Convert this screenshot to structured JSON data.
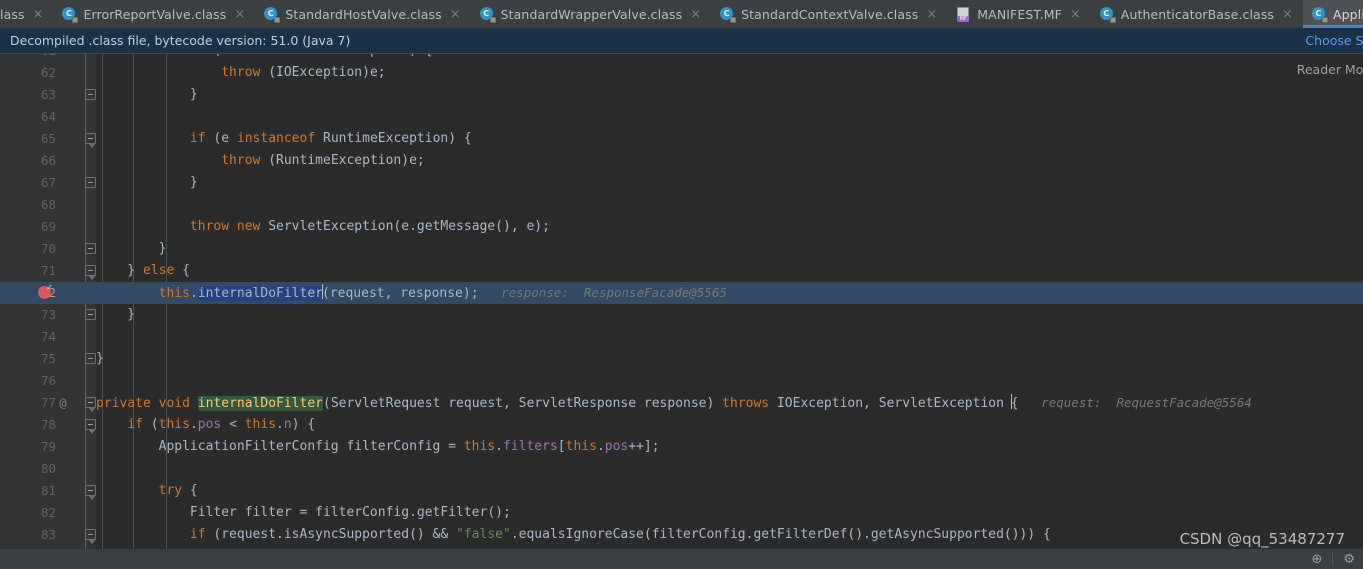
{
  "tabs": [
    {
      "label": "lass",
      "icon": "class-file-icon",
      "active": false,
      "truncated": true
    },
    {
      "label": "ErrorReportValve.class",
      "icon": "class-file-icon",
      "active": false
    },
    {
      "label": "StandardHostValve.class",
      "icon": "class-file-icon",
      "active": false
    },
    {
      "label": "StandardWrapperValve.class",
      "icon": "class-file-icon",
      "active": false
    },
    {
      "label": "StandardContextValve.class",
      "icon": "class-file-icon",
      "active": false
    },
    {
      "label": "MANIFEST.MF",
      "icon": "manifest-file-icon",
      "active": false
    },
    {
      "label": "AuthenticatorBase.class",
      "icon": "class-file-icon",
      "active": false
    },
    {
      "label": "ApplicationFilterChain.class",
      "icon": "class-file-icon",
      "active": true
    }
  ],
  "tab_close_glyph": "×",
  "notification": {
    "message": "Decompiled .class file, bytecode version: 51.0 (Java 7)",
    "action_label": "Choose Sources",
    "link_color": "#589df6",
    "background": "#1b3147"
  },
  "editor": {
    "reader_mode_label": "Reader Mode",
    "current_line": 72,
    "breakpoint_line": 72,
    "selected_token": "internalDoFilter",
    "lines": [
      {
        "no": 61,
        "clipped": true,
        "tokens": [
          {
            "t": "            ",
            "c": "pln"
          },
          {
            "t": "if",
            "c": "kw"
          },
          {
            "t": " (e ",
            "c": "pln"
          },
          {
            "t": "instanceof",
            "c": "kw"
          },
          {
            "t": " IOException) {",
            "c": "pln"
          }
        ]
      },
      {
        "no": 62,
        "tokens": [
          {
            "t": "                ",
            "c": "pln"
          },
          {
            "t": "throw",
            "c": "kw"
          },
          {
            "t": " (IOException)e;",
            "c": "pln"
          }
        ]
      },
      {
        "no": 63,
        "fold": true,
        "tokens": [
          {
            "t": "            }",
            "c": "pln"
          }
        ]
      },
      {
        "no": 64,
        "tokens": []
      },
      {
        "no": 65,
        "fold": true,
        "foldArrow": true,
        "tokens": [
          {
            "t": "            ",
            "c": "pln"
          },
          {
            "t": "if",
            "c": "kw"
          },
          {
            "t": " (e ",
            "c": "pln"
          },
          {
            "t": "instanceof",
            "c": "kw"
          },
          {
            "t": " RuntimeException) {",
            "c": "pln"
          }
        ]
      },
      {
        "no": 66,
        "tokens": [
          {
            "t": "                ",
            "c": "pln"
          },
          {
            "t": "throw",
            "c": "kw"
          },
          {
            "t": " (RuntimeException)e;",
            "c": "pln"
          }
        ]
      },
      {
        "no": 67,
        "fold": true,
        "tokens": [
          {
            "t": "            }",
            "c": "pln"
          }
        ]
      },
      {
        "no": 68,
        "tokens": []
      },
      {
        "no": 69,
        "tokens": [
          {
            "t": "            ",
            "c": "pln"
          },
          {
            "t": "throw",
            "c": "kw"
          },
          {
            "t": " ",
            "c": "pln"
          },
          {
            "t": "new",
            "c": "kw"
          },
          {
            "t": " ServletException(e.getMessage(), e);",
            "c": "pln"
          }
        ]
      },
      {
        "no": 70,
        "fold": true,
        "tokens": [
          {
            "t": "        }",
            "c": "pln"
          }
        ]
      },
      {
        "no": 71,
        "fold": true,
        "foldArrow": true,
        "tokens": [
          {
            "t": "    } ",
            "c": "pln"
          },
          {
            "t": "else",
            "c": "kw"
          },
          {
            "t": " {",
            "c": "pln"
          }
        ]
      },
      {
        "no": 72,
        "highlight": true,
        "breakpoint": true,
        "tokens": [
          {
            "t": "        ",
            "c": "pln"
          },
          {
            "t": "this",
            "c": "kw"
          },
          {
            "t": ".",
            "c": "pln"
          },
          {
            "t": "internalDoFilter",
            "c": "sel"
          },
          {
            "t": "|",
            "c": "caret"
          },
          {
            "t": "(request, response);",
            "c": "pln"
          }
        ],
        "hint": "response:  ResponseFacade@5565"
      },
      {
        "no": 73,
        "fold": true,
        "tokens": [
          {
            "t": "    }",
            "c": "pln"
          }
        ]
      },
      {
        "no": 74,
        "tokens": []
      },
      {
        "no": 75,
        "fold": true,
        "tokens": [
          {
            "t": "}",
            "c": "pln"
          }
        ]
      },
      {
        "no": 76,
        "tokens": []
      },
      {
        "no": 77,
        "fold": true,
        "foldArrow": true,
        "override": "@",
        "tokens": [
          {
            "t": "",
            "c": "pln"
          },
          {
            "t": "private",
            "c": "kw"
          },
          {
            "t": " ",
            "c": "pln"
          },
          {
            "t": "void",
            "c": "kw"
          },
          {
            "t": " ",
            "c": "pln"
          },
          {
            "t": "internalDoFilter",
            "c": "mth occ"
          },
          {
            "t": "(ServletRequest request, ServletResponse response) ",
            "c": "pln"
          },
          {
            "t": "throws",
            "c": "kw"
          },
          {
            "t": " IOException, ServletException ",
            "c": "pln"
          },
          {
            "t": "|",
            "c": "caret"
          },
          {
            "t": "{",
            "c": "pln"
          }
        ],
        "hint": "request:  RequestFacade@5564"
      },
      {
        "no": 78,
        "fold": true,
        "foldArrow": true,
        "tokens": [
          {
            "t": "    ",
            "c": "pln"
          },
          {
            "t": "if",
            "c": "kw"
          },
          {
            "t": " (",
            "c": "pln"
          },
          {
            "t": "this",
            "c": "kw"
          },
          {
            "t": ".",
            "c": "pln"
          },
          {
            "t": "pos",
            "c": "fld"
          },
          {
            "t": " < ",
            "c": "pln"
          },
          {
            "t": "this",
            "c": "kw"
          },
          {
            "t": ".",
            "c": "pln"
          },
          {
            "t": "n",
            "c": "fld"
          },
          {
            "t": ") {",
            "c": "pln"
          }
        ]
      },
      {
        "no": 79,
        "tokens": [
          {
            "t": "        ApplicationFilterConfig filterConfig = ",
            "c": "pln"
          },
          {
            "t": "this",
            "c": "kw"
          },
          {
            "t": ".",
            "c": "pln"
          },
          {
            "t": "filters",
            "c": "fld"
          },
          {
            "t": "[",
            "c": "pln"
          },
          {
            "t": "this",
            "c": "kw"
          },
          {
            "t": ".",
            "c": "pln"
          },
          {
            "t": "pos",
            "c": "fld"
          },
          {
            "t": "++];",
            "c": "pln"
          }
        ]
      },
      {
        "no": 80,
        "tokens": []
      },
      {
        "no": 81,
        "fold": true,
        "foldArrow": true,
        "tokens": [
          {
            "t": "        ",
            "c": "pln"
          },
          {
            "t": "try",
            "c": "kw"
          },
          {
            "t": " {",
            "c": "pln"
          }
        ]
      },
      {
        "no": 82,
        "tokens": [
          {
            "t": "            Filter filter = filterConfig.getFilter();",
            "c": "pln"
          }
        ]
      },
      {
        "no": 83,
        "fold": true,
        "foldArrow": true,
        "clippedBottom": true,
        "tokens": [
          {
            "t": "            ",
            "c": "pln"
          },
          {
            "t": "if",
            "c": "kw"
          },
          {
            "t": " (request.isAsyncSupported() && ",
            "c": "pln"
          },
          {
            "t": "\"false\"",
            "c": "str"
          },
          {
            "t": ".equalsIgnoreCase(filterConfig.getFilterDef().getAsyncSupported())) {",
            "c": "pln"
          }
        ]
      }
    ]
  },
  "statusbar": {
    "icons": [
      {
        "name": "cursor-target-icon",
        "glyph": "⊕"
      },
      {
        "name": "settings-gear-icon",
        "glyph": "⚙"
      }
    ]
  },
  "watermark": "CSDN @qq_53487277",
  "colors": {
    "editor_bg": "#2b2b2b",
    "gutter_bg": "#313335",
    "tabbar_bg": "#3c3f41",
    "active_tab_bg": "#4e5254",
    "active_tab_underline": "#4a88c7",
    "line_highlight": "#344a64",
    "keyword": "#cc7832",
    "string": "#6a8759",
    "field": "#9876aa",
    "method": "#ffc66d",
    "plain": "#a9b7c6",
    "hint": "#787878",
    "selection": "#214283",
    "occurrence": "#32593d",
    "breakpoint": "#db5860"
  }
}
